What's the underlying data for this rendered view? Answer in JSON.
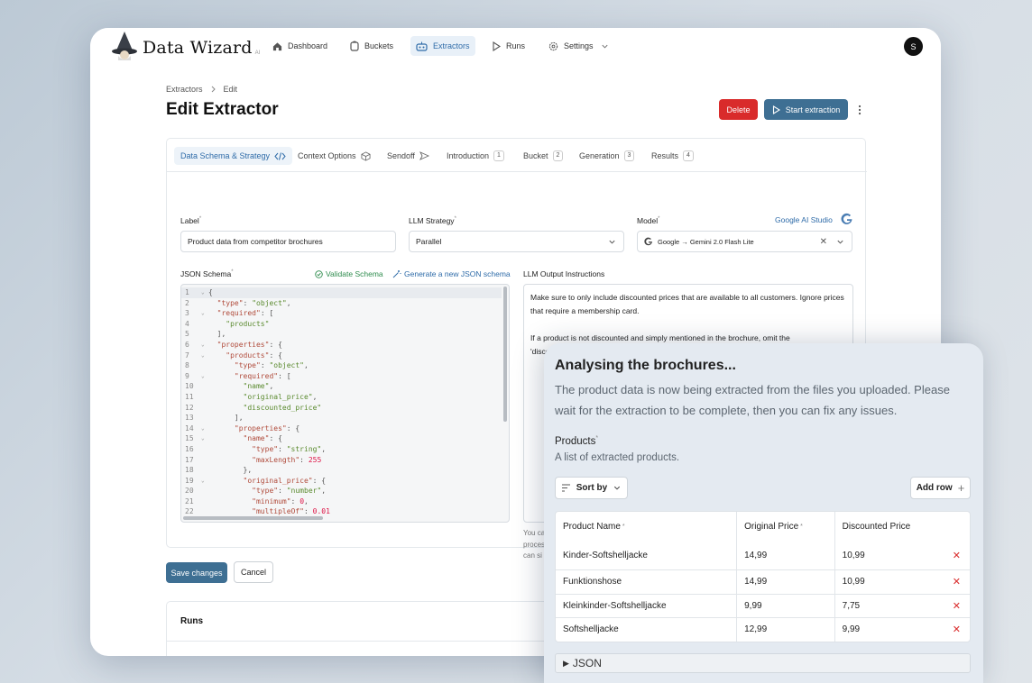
{
  "app": {
    "name": "Data Wizard",
    "sup": "AI",
    "avatar_initial": "S"
  },
  "nav": [
    {
      "label": "Dashboard",
      "icon": "home-icon"
    },
    {
      "label": "Buckets",
      "icon": "bucket-icon"
    },
    {
      "label": "Extractors",
      "icon": "robot-icon",
      "active": true
    },
    {
      "label": "Runs",
      "icon": "play-icon"
    },
    {
      "label": "Settings",
      "icon": "gear-icon"
    }
  ],
  "breadcrumb": {
    "root": "Extractors",
    "current": "Edit"
  },
  "page": {
    "title": "Edit Extractor",
    "delete_label": "Delete",
    "start_label": "Start extraction"
  },
  "tabs": [
    {
      "label": "Data Schema & Strategy",
      "active": true
    },
    {
      "label": "Context Options"
    },
    {
      "label": "Sendoff"
    },
    {
      "label": "Introduction",
      "badge": "1"
    },
    {
      "label": "Bucket",
      "badge": "2"
    },
    {
      "label": "Generation",
      "badge": "3"
    },
    {
      "label": "Results",
      "badge": "4"
    }
  ],
  "form": {
    "label_label": "Label",
    "label_value": "Product data from competitor brochures",
    "strategy_label": "LLM Strategy",
    "strategy_value": "Parallel",
    "model_label": "Model",
    "model_provider": "Google AI Studio",
    "model_value": "Google → Gemini 2.0 Flash Lite",
    "schema_label": "JSON Schema",
    "validate_label": "Validate Schema",
    "generate_label": "Generate a new JSON schema",
    "output_label": "LLM Output Instructions",
    "output_text_1": "Make sure to only include discounted prices that are available to all customers. Ignore prices that require a membership card.",
    "output_text_2": "If a product is not discounted and simply mentioned in the brochure, omit the 'discounted_price' property by setting it to null. Make sure to still include it.",
    "hint_1": "You ca",
    "hint_2": "proces",
    "hint_3": "can si"
  },
  "code": [
    "{",
    "  \"type\": \"object\",",
    "  \"required\": [",
    "    \"products\"",
    "  ],",
    "  \"properties\": {",
    "    \"products\": {",
    "      \"type\": \"object\",",
    "      \"required\": [",
    "        \"name\",",
    "        \"original_price\",",
    "        \"discounted_price\"",
    "      ],",
    "      \"properties\": {",
    "        \"name\": {",
    "          \"type\": \"string\",",
    "          \"maxLength\": 255",
    "        },",
    "        \"original_price\": {",
    "          \"type\": \"number\",",
    "          \"minimum\": 0,",
    "          \"multipleOf\": 0.01"
  ],
  "footer": {
    "save_label": "Save changes",
    "cancel_label": "Cancel",
    "runs_label": "Runs"
  },
  "panel": {
    "title": "Analysing the brochures...",
    "description": "The product data is now being extracted from the files you uploaded. Please wait for the extraction to be complete, then you can fix any issues.",
    "products_label": "Products",
    "products_desc": "A list of extracted products.",
    "sort_label": "Sort by",
    "add_row_label": "Add row",
    "columns": [
      "Product Name",
      "Original Price",
      "Discounted Price"
    ],
    "rows": [
      [
        "Kinder-Softshelljacke",
        "14,99",
        "10,99"
      ],
      [
        "Funktionshose",
        "14,99",
        "10,99"
      ],
      [
        "Kleinkinder-Softshelljacke",
        "9,99",
        "7,75"
      ],
      [
        "Softshelljacke",
        "12,99",
        "9,99"
      ]
    ],
    "json_label": "JSON"
  },
  "colors": {
    "accent": "#2e6ba8",
    "delete": "#d92b2b",
    "start": "#3e6f93",
    "save": "#3e6f93"
  }
}
